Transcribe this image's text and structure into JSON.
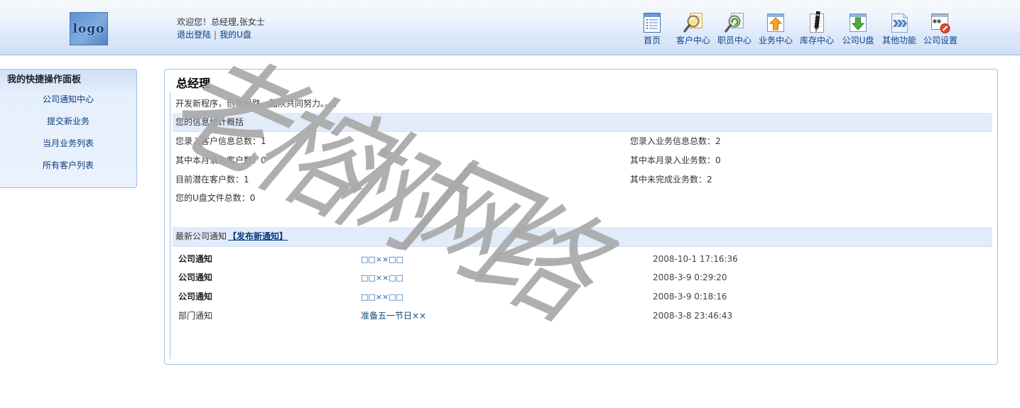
{
  "header": {
    "logo_text": "logo",
    "welcome": "欢迎您！总经理,张女士",
    "logout": "退出登陆",
    "separator": "|",
    "my_udisk": "我的U盘",
    "nav": [
      {
        "label": "首页",
        "icon": "home-list-icon"
      },
      {
        "label": "客户中心",
        "icon": "customer-search-icon"
      },
      {
        "label": "职员中心",
        "icon": "staff-search-icon"
      },
      {
        "label": "业务中心",
        "icon": "business-upload-icon"
      },
      {
        "label": "库存中心",
        "icon": "inventory-pen-icon"
      },
      {
        "label": "公司U盘",
        "icon": "udisk-download-icon"
      },
      {
        "label": "其他功能",
        "icon": "more-arrows-icon"
      },
      {
        "label": "公司设置",
        "icon": "settings-icon"
      }
    ]
  },
  "sidebar": {
    "title": "我的快捷操作面板",
    "items": [
      "公司通知中心",
      "提交新业务",
      "当月业务列表",
      "所有客户列表"
    ]
  },
  "main": {
    "title": "总经理",
    "motto": "开发新程序，创新思路，团队共同努力。。。。",
    "stats_header": "您的信息统计概括",
    "stats_left": [
      "您录入客户信息总数：1",
      "其中本月录入客户数：0",
      "目前潜在客户数：1",
      "您的U盘文件总数：0"
    ],
    "stats_right": [
      "您录入业务信息总数：2",
      "其中本月录入业务数：0",
      "其中未完成业务数：2"
    ],
    "notices_header": "最新公司通知",
    "publish_link": "【发布新通知】",
    "notices": [
      {
        "type": "公司通知",
        "title": "□□××□□",
        "date": "2008-10-1 17:16:36"
      },
      {
        "type": "公司通知",
        "title": "□□××□□",
        "date": "2008-3-9 0:29:20"
      },
      {
        "type": "公司通知",
        "title": "□□××□□",
        "date": "2008-3-9 0:18:16"
      },
      {
        "type": "部门通知",
        "title": "准备五一节日××",
        "date": "2008-3-8 23:46:43"
      }
    ]
  },
  "watermark": [
    "老",
    "榕",
    "树",
    "网",
    "络"
  ],
  "colors": {
    "border": "#9ec0e6",
    "link": "#0b3c7a",
    "section_bar": "#e1ebfa",
    "watermark": "#a9a9a9"
  }
}
